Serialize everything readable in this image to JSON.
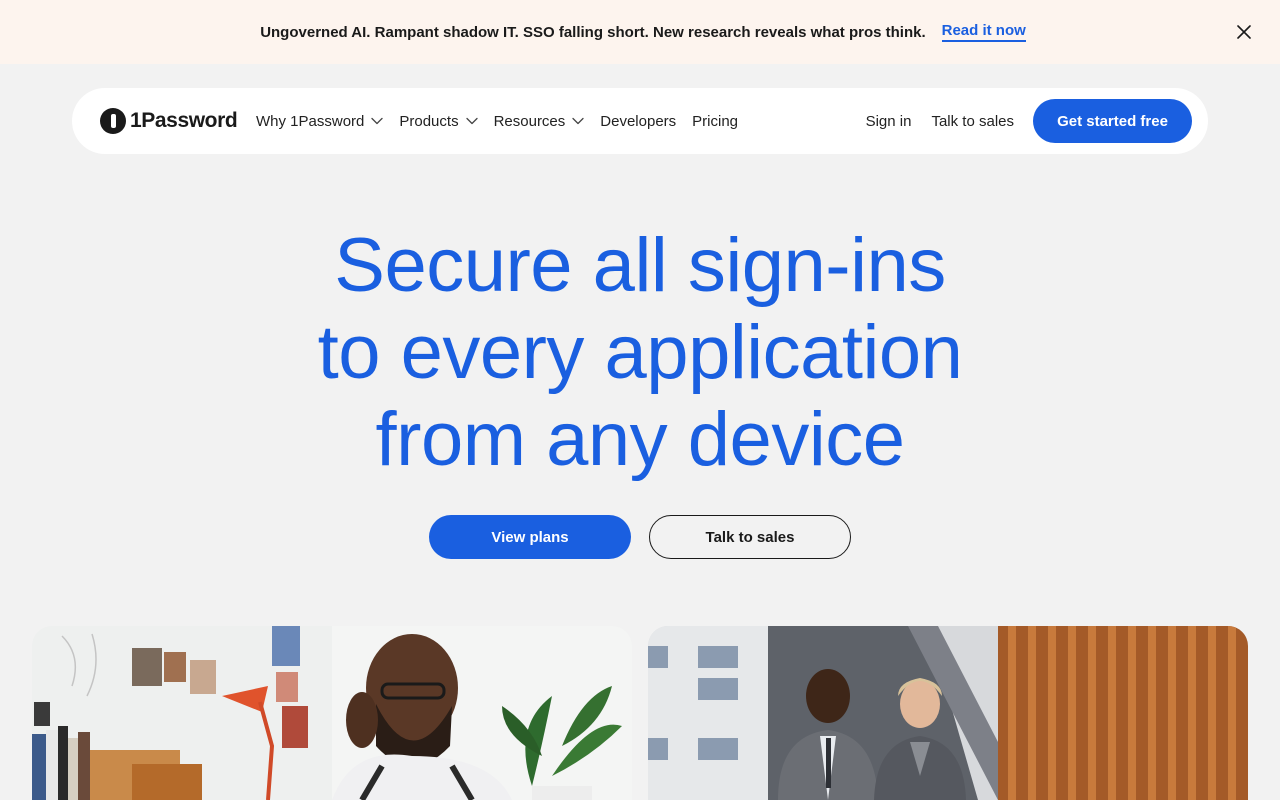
{
  "banner": {
    "text": "Ungoverned AI. Rampant shadow IT. SSO falling short. New research reveals what pros think.",
    "link": "Read it now",
    "close_icon": "close-icon"
  },
  "nav": {
    "logo_text": "1Password",
    "items": [
      {
        "label": "Why 1Password",
        "dropdown": true
      },
      {
        "label": "Products",
        "dropdown": true
      },
      {
        "label": "Resources",
        "dropdown": true
      },
      {
        "label": "Developers",
        "dropdown": false
      },
      {
        "label": "Pricing",
        "dropdown": false
      }
    ],
    "sign_in": "Sign in",
    "talk_to_sales": "Talk to sales",
    "cta": "Get started free"
  },
  "hero": {
    "lines": [
      "Secure all sign-ins",
      "to every application",
      "from any device"
    ],
    "primary_button": "View plans",
    "secondary_button": "Talk to sales"
  },
  "images": [
    {
      "name": "man-on-phone-photo"
    },
    {
      "name": "colleagues-walking-photo"
    }
  ],
  "colors": {
    "accent": "#1a5fe0",
    "banner_bg": "#fdf4ee",
    "page_bg": "#f2f2f2"
  }
}
